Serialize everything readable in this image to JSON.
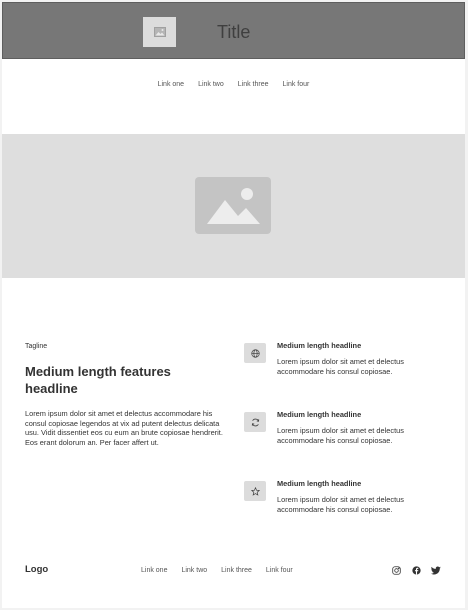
{
  "header": {
    "logo_icon": "image-icon",
    "title": "Title"
  },
  "nav": {
    "links": [
      "Link one",
      "Link two",
      "Link three",
      "Link four"
    ]
  },
  "hero": {
    "image_icon": "image-placeholder-icon"
  },
  "features": {
    "tagline": "Tagline",
    "headline": "Medium length features headline",
    "body": "Lorem ipsum dolor sit amet et delectus accommodare his consul copiosae legendos at vix ad putent delectus delicata usu. Vidit dissentiet eos cu eum an brute copiosae hendrerit. Eos erant dolorum an. Per facer affert ut.",
    "items": [
      {
        "icon": "globe-icon",
        "title": "Medium length headline",
        "body": "Lorem ipsum dolor sit amet et delectus accommodare his consul copiosae."
      },
      {
        "icon": "refresh-icon",
        "title": "Medium length headline",
        "body": "Lorem ipsum dolor sit amet et delectus accommodare his consul copiosae."
      },
      {
        "icon": "star-icon",
        "title": "Medium length headline",
        "body": "Lorem ipsum dolor sit amet et delectus accommodare his consul copiosae."
      }
    ]
  },
  "footer": {
    "logo": "Logo",
    "links": [
      "Link one",
      "Link two",
      "Link three",
      "Link four"
    ],
    "social_icons": [
      "instagram-icon",
      "facebook-icon",
      "twitter-icon"
    ]
  },
  "colors": {
    "header_bg": "#777777",
    "hero_bg": "#dedede",
    "placeholder": "#c4c4c4"
  }
}
